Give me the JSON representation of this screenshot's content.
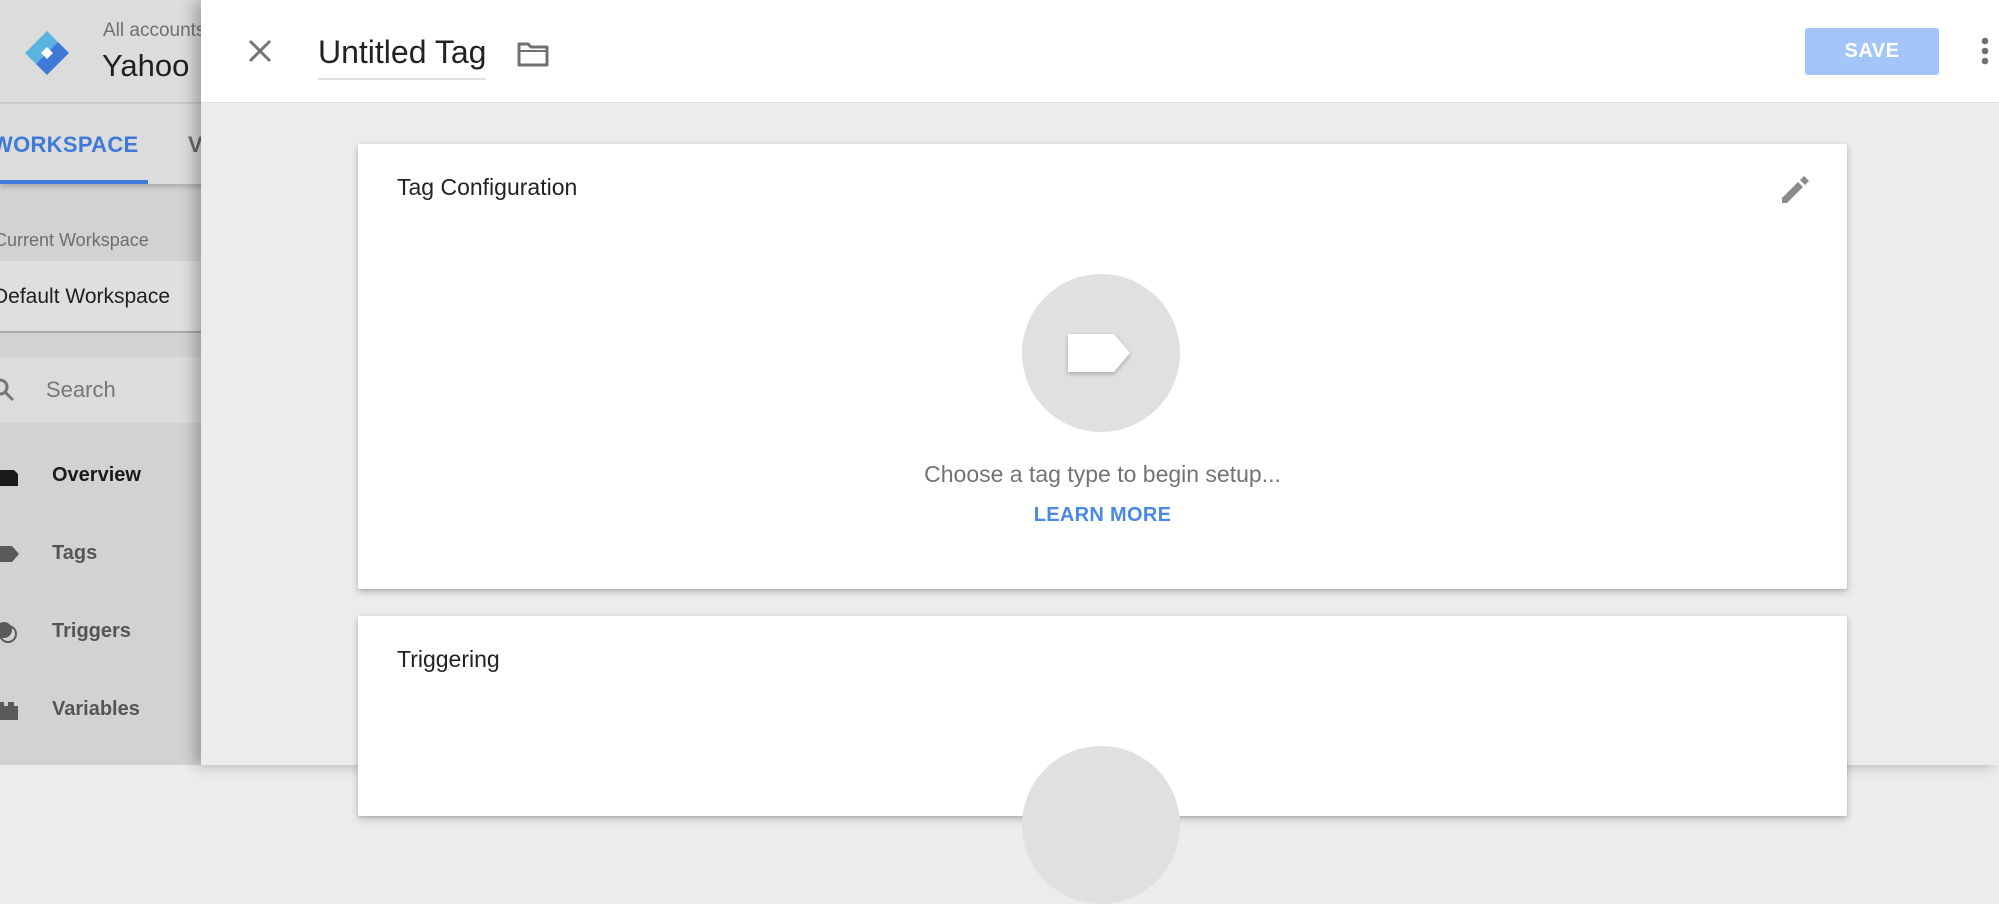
{
  "sidebar": {
    "account_label": "All accounts",
    "container_name": "Yahoo",
    "tabs": [
      {
        "label": "WORKSPACE",
        "active": true
      },
      {
        "label": "VERSIONS",
        "active": false
      }
    ],
    "workspace_label": "Current Workspace",
    "workspace_value": "Default Workspace",
    "search_placeholder": "Search",
    "nav_items": [
      {
        "label": "Overview",
        "icon": "overview-icon",
        "active": true
      },
      {
        "label": "Tags",
        "icon": "tag-icon",
        "active": false
      },
      {
        "label": "Triggers",
        "icon": "trigger-icon",
        "active": false
      },
      {
        "label": "Variables",
        "icon": "variables-icon",
        "active": false
      }
    ]
  },
  "panel": {
    "title": "Untitled Tag",
    "save_label": "SAVE",
    "icons": {
      "close": "close-icon",
      "folder": "folder-icon",
      "more": "more-vert-icon",
      "edit": "pencil-icon"
    },
    "tag_configuration": {
      "title": "Tag Configuration",
      "empty_text": "Choose a tag type to begin setup...",
      "learn_more": "LEARN MORE"
    },
    "triggering": {
      "title": "Triggering"
    }
  },
  "colors": {
    "accent": "#3f7ad8",
    "save_disabled": "#a4c5f7",
    "link": "#4a87e8",
    "logo_light": "#5bb3e0",
    "logo_dark": "#3e79d8"
  }
}
